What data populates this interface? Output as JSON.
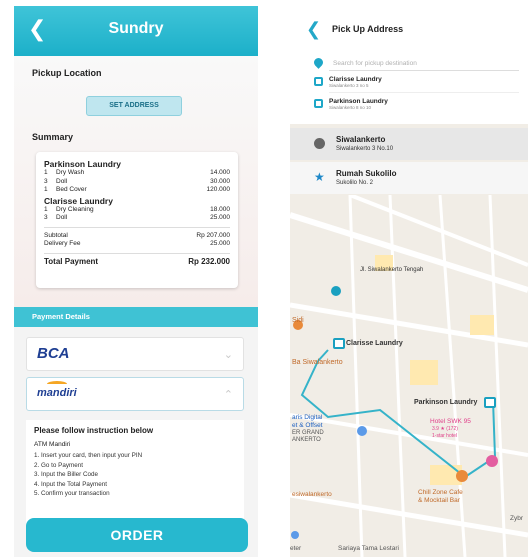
{
  "left": {
    "header": {
      "back_icon": "chevron-left-icon",
      "title": "Sundry"
    },
    "pickup": {
      "label": "Pickup Location",
      "button": "SET ADDRESS"
    },
    "summary": {
      "label": "Summary",
      "shops": [
        {
          "name": "Parkinson Laundry",
          "items": [
            {
              "qty": "1",
              "name": "Dry Wash",
              "price": "14.000"
            },
            {
              "qty": "3",
              "name": "Doll",
              "price": "30.000"
            },
            {
              "qty": "1",
              "name": "Bed Cover",
              "price": "120.000"
            }
          ]
        },
        {
          "name": "Clarisse Laundry",
          "items": [
            {
              "qty": "1",
              "name": "Dry Cleaning",
              "price": "18.000"
            },
            {
              "qty": "3",
              "name": "Doll",
              "price": "25.000"
            }
          ]
        }
      ],
      "subtotal_label": "Subtotal",
      "subtotal": "Rp 207.000",
      "delivery_label": "Delivery Fee",
      "delivery": "25.000",
      "total_label": "Total Payment",
      "total": "Rp 232.000"
    },
    "payment": {
      "label": "Payment Details",
      "banks": [
        {
          "name": "BCA"
        },
        {
          "name": "mandiri"
        }
      ],
      "instruction_title": "Please follow instruction below",
      "instruction_sub": "ATM Mandiri",
      "steps": [
        "1. Insert your card, then input your PIN",
        "2. Go to Payment",
        "3. Input the Biller Code",
        "4. Input the Total Payment",
        "5. Confirm your transaction"
      ]
    },
    "order_button": "ORDER"
  },
  "right": {
    "header": {
      "title": "Pick Up Address"
    },
    "search_placeholder": "Search for pickup destination",
    "stops": [
      {
        "name": "Clarisse Laundry",
        "addr": "Siwalankerto 3 no 5"
      },
      {
        "name": "Parkinson Laundry",
        "addr": "Siwalankerto 8 no 10"
      }
    ],
    "recent": [
      {
        "name": "Siwalankerto",
        "addr": "Siwalankerto 3 No.10",
        "icon": "clock-icon"
      },
      {
        "name": "Rumah Sukolilo",
        "addr": "Sukolilo No. 2",
        "icon": "star-icon"
      }
    ],
    "map_labels": {
      "jl": "Jl. Siwalankerto Tengah",
      "clarisse": "Clarisse Laundry",
      "parkinson": "Parkinson Laundry",
      "sidi": "Sidi",
      "ba": "Ba Siwalankerto",
      "digital": "aris Digital",
      "offset": "et & Offset",
      "grand": "ER GRAND",
      "ankerto": "ANKERTO",
      "hotel": "Hotel SWK 95",
      "hotel_rating": "3.9 ★ (172)",
      "hotel_type": "1-star hotel",
      "chill": "Chill Zone Cafe",
      "mocktail": "& Mocktail Bar",
      "siwalan": "esiwalankerto",
      "sariaya": "Sariaya Tama Lestari",
      "zybr": "Zybr",
      "eter": "eter"
    }
  }
}
